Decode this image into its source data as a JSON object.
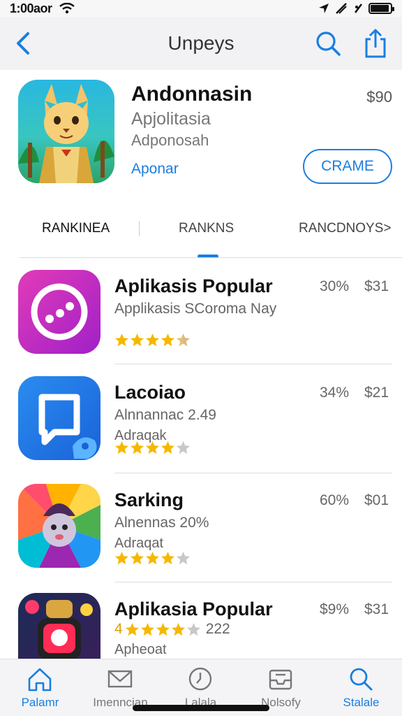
{
  "status_bar": {
    "time": "1:00aor"
  },
  "nav": {
    "title": "Unpeys"
  },
  "featured": {
    "name": "Andonnasin",
    "subtitle": "Apjolitasia",
    "developer": "Adponosah",
    "link": "Aponar",
    "price": "$90",
    "button_label": "CRAME"
  },
  "tabs": [
    {
      "label": "RANKINEA",
      "active": true
    },
    {
      "label": "RANKNS",
      "active": false
    },
    {
      "label": "RANCDNOYS>",
      "active": false
    }
  ],
  "apps": [
    {
      "name": "Aplikasis Popular",
      "line1": "Applikasis SCoroma Nay",
      "line2": "",
      "percent": "30%",
      "price": "$31",
      "rating": 4.5,
      "rating_count": "",
      "icon": "chat-bubble-dots-icon"
    },
    {
      "name": "Lacoiao",
      "line1": "Alnnannac 2.49",
      "line2": "Adraqak",
      "percent": "34%",
      "price": "$21",
      "rating": 4,
      "rating_count": "",
      "icon": "message-square-icon"
    },
    {
      "name": "Sarking",
      "line1": "Alnennas 20%",
      "line2": "Adraqat",
      "percent": "60%",
      "price": "$01",
      "rating": 4,
      "rating_count": "",
      "icon": "game-character-icon"
    },
    {
      "name": "Aplikasia Popular",
      "line1": "",
      "line2": "Apheoat",
      "percent": "$9%",
      "price": "$31",
      "rating": 4,
      "rating_count": "222",
      "rating_prefix": "4",
      "icon": "robot-game-icon"
    }
  ],
  "tab_bar": [
    {
      "label": "Palamr",
      "icon": "home-icon",
      "active": true
    },
    {
      "label": "Imenncian",
      "icon": "mail-icon",
      "active": false
    },
    {
      "label": "Lalala",
      "icon": "clock-icon",
      "active": false
    },
    {
      "label": "Nolsofy",
      "icon": "inbox-icon",
      "active": false
    },
    {
      "label": "Stalale",
      "icon": "search-icon",
      "active": true
    }
  ],
  "colors": {
    "accent": "#1a7ee0",
    "star": "#f5b800",
    "star_empty": "#c8c8c8"
  }
}
